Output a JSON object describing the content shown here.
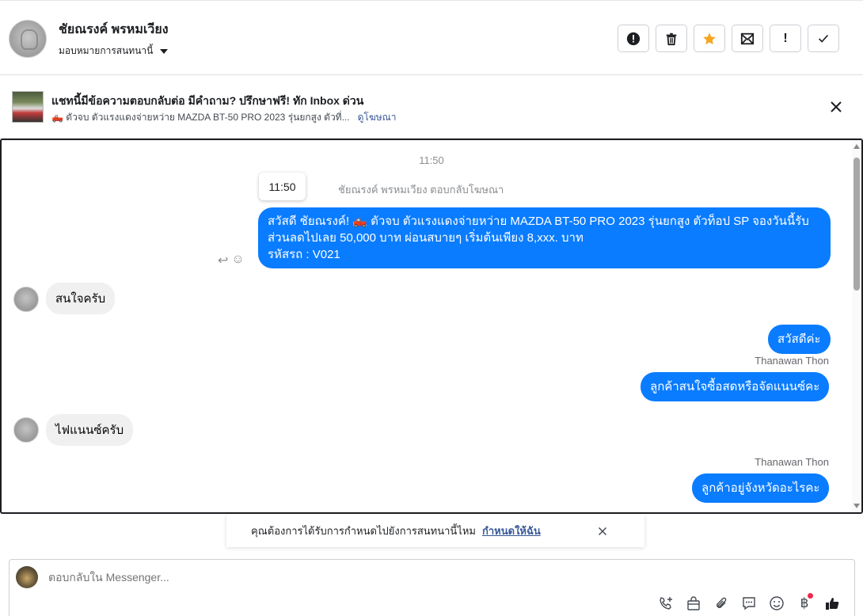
{
  "header": {
    "contact_name": "ชัยณรงค์ พรหมเวียง",
    "assign_label": "มอบหมายการสนทนานี้",
    "actions": [
      {
        "name": "mark-spam-button",
        "icon": "alert-circle-icon"
      },
      {
        "name": "delete-button",
        "icon": "trash-icon"
      },
      {
        "name": "star-button",
        "icon": "star-icon",
        "color": "#f5a623"
      },
      {
        "name": "mark-unread-button",
        "icon": "envelope-icon"
      },
      {
        "name": "follow-up-button",
        "icon": "exclamation-icon",
        "label": "!"
      },
      {
        "name": "mark-done-button",
        "icon": "check-icon"
      }
    ]
  },
  "ad": {
    "title": "แชทนี้มีข้อความตอบกลับต่อ มีคำถาม? ปรึกษาฟรี! ทัก Inbox ด่วน",
    "subtitle": "🛻 ตัวจบ ตัวแรงแดงจ่ายหว่าย MAZDA BT-50 PRO 2023 รุ่นยกสูง ตัวที่...",
    "link": "ดูโฆษณา"
  },
  "chat": {
    "timestamp": "11:50",
    "tooltip_time": "11:50",
    "reply_label": "ชัยณรงค์ พรหมเวียง ตอบกลับโฆษณา",
    "messages": [
      {
        "dir": "out",
        "lines": [
          "สวัสดี ชัยณรงค์! 🛻 ตัวจบ ตัวแรงแดงจ่ายหว่าย MAZDA BT-50 PRO 2023 รุ่นยกสูง ตัวท็อป SP จองวันนี้รับ",
          "ส่วนลดไปเลย 50,000 บาท ผ่อนสบายๆ เริ่มต้นเพียง 8,xxx. บาท",
          "รหัสรถ : V021"
        ]
      },
      {
        "dir": "in",
        "text": "สนใจครับ"
      },
      {
        "dir": "out",
        "text": "สวัสดีค่ะ"
      },
      {
        "dir": "out",
        "sender": "Thanawan Thon",
        "text": "ลูกค้าสนใจซื้อสดหรือจัดแนนซ์คะ"
      },
      {
        "dir": "in",
        "text": "ไฟแนนซ์ครับ"
      },
      {
        "dir": "out",
        "sender": "Thanawan Thon",
        "text": "ลูกค้าอยู่จังหวัดอะไรคะ"
      }
    ],
    "bubble_color": "#0a7cff"
  },
  "reminder": {
    "text": "คุณต้องการได้รับการกำหนดไปยังการสนทนานี้ไหม",
    "link": "กำหนดให้ฉัน"
  },
  "composer": {
    "placeholder": "ตอบกลับใน Messenger...",
    "tools": [
      "add-contact-icon",
      "shopping-bag-icon",
      "paperclip-icon",
      "saved-reply-icon",
      "emoji-icon",
      "baht-icon",
      "thumbs-up-icon"
    ]
  }
}
